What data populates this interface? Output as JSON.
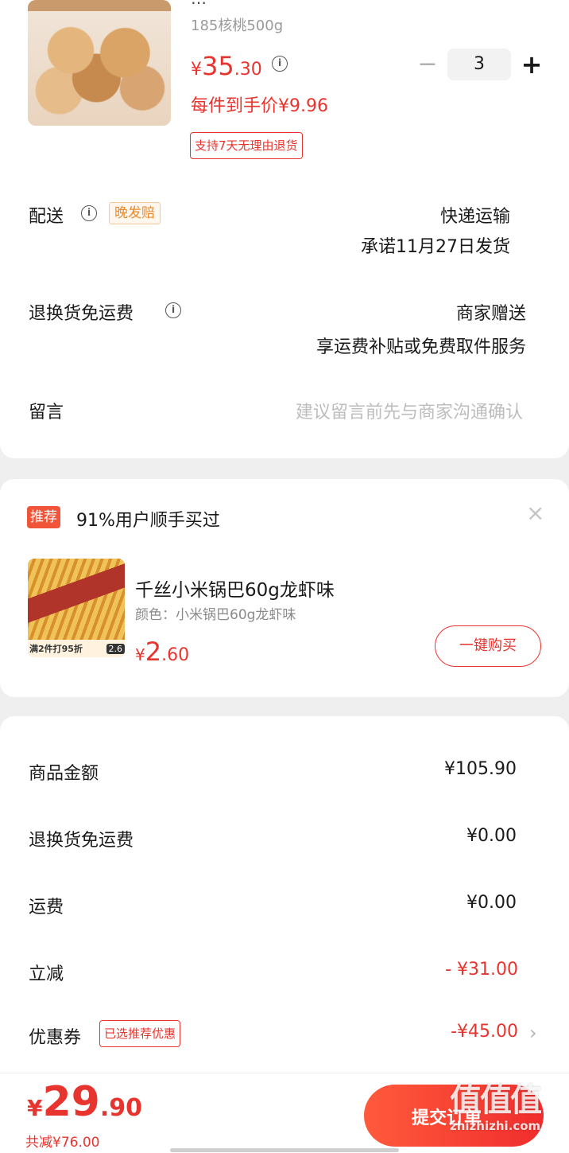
{
  "product": {
    "title_partial": "…",
    "spec": "185核桃500g",
    "price_symbol": "¥",
    "price_int": "35",
    "price_dec": ".30",
    "unit_price": "每件到手价¥9.96",
    "return_tag": "支持7天无理由退货",
    "quantity": "3",
    "minus": "−",
    "plus": "+"
  },
  "delivery": {
    "label": "配送",
    "badge": "晚发赔",
    "method": "快递运输",
    "promise": "承诺11月27日发货"
  },
  "return_shipping": {
    "label": "退换货免运费",
    "value": "商家赠送",
    "desc": "享运费补贴或免费取件服务"
  },
  "message": {
    "label": "留言",
    "placeholder": "建议留言前先与商家沟通确认"
  },
  "recommend": {
    "badge": "推荐",
    "headline": "91%用户顺手买过",
    "close": "×",
    "item_name": "千丝小米锅巴60g龙虾味",
    "item_spec": "颜色：小米锅巴60g龙虾味",
    "price_symbol": "¥",
    "price_int": "2",
    "price_dec": ".60",
    "promo": "满2件打95折",
    "promo_price": "2.6",
    "buy_button": "一键购买"
  },
  "summary": {
    "rows": [
      {
        "label": "商品金额",
        "value": "¥105.90"
      },
      {
        "label": "退换货免运费",
        "value": "¥0.00"
      },
      {
        "label": "运费",
        "value": "¥0.00"
      },
      {
        "label": "立减",
        "value": "- ¥31.00"
      },
      {
        "label": "优惠券",
        "value": "-¥45.00",
        "badge": "已选推荐优惠"
      }
    ]
  },
  "footer": {
    "price_symbol": "¥",
    "price_int": "29",
    "price_dec": ".90",
    "saved": "共减¥76.00",
    "submit": "提交订单",
    "watermark": "值|什么值得买 zhizhizhi.com"
  },
  "colors": {
    "accent": "#e8342e",
    "badge_orange": "#e98a2c"
  }
}
